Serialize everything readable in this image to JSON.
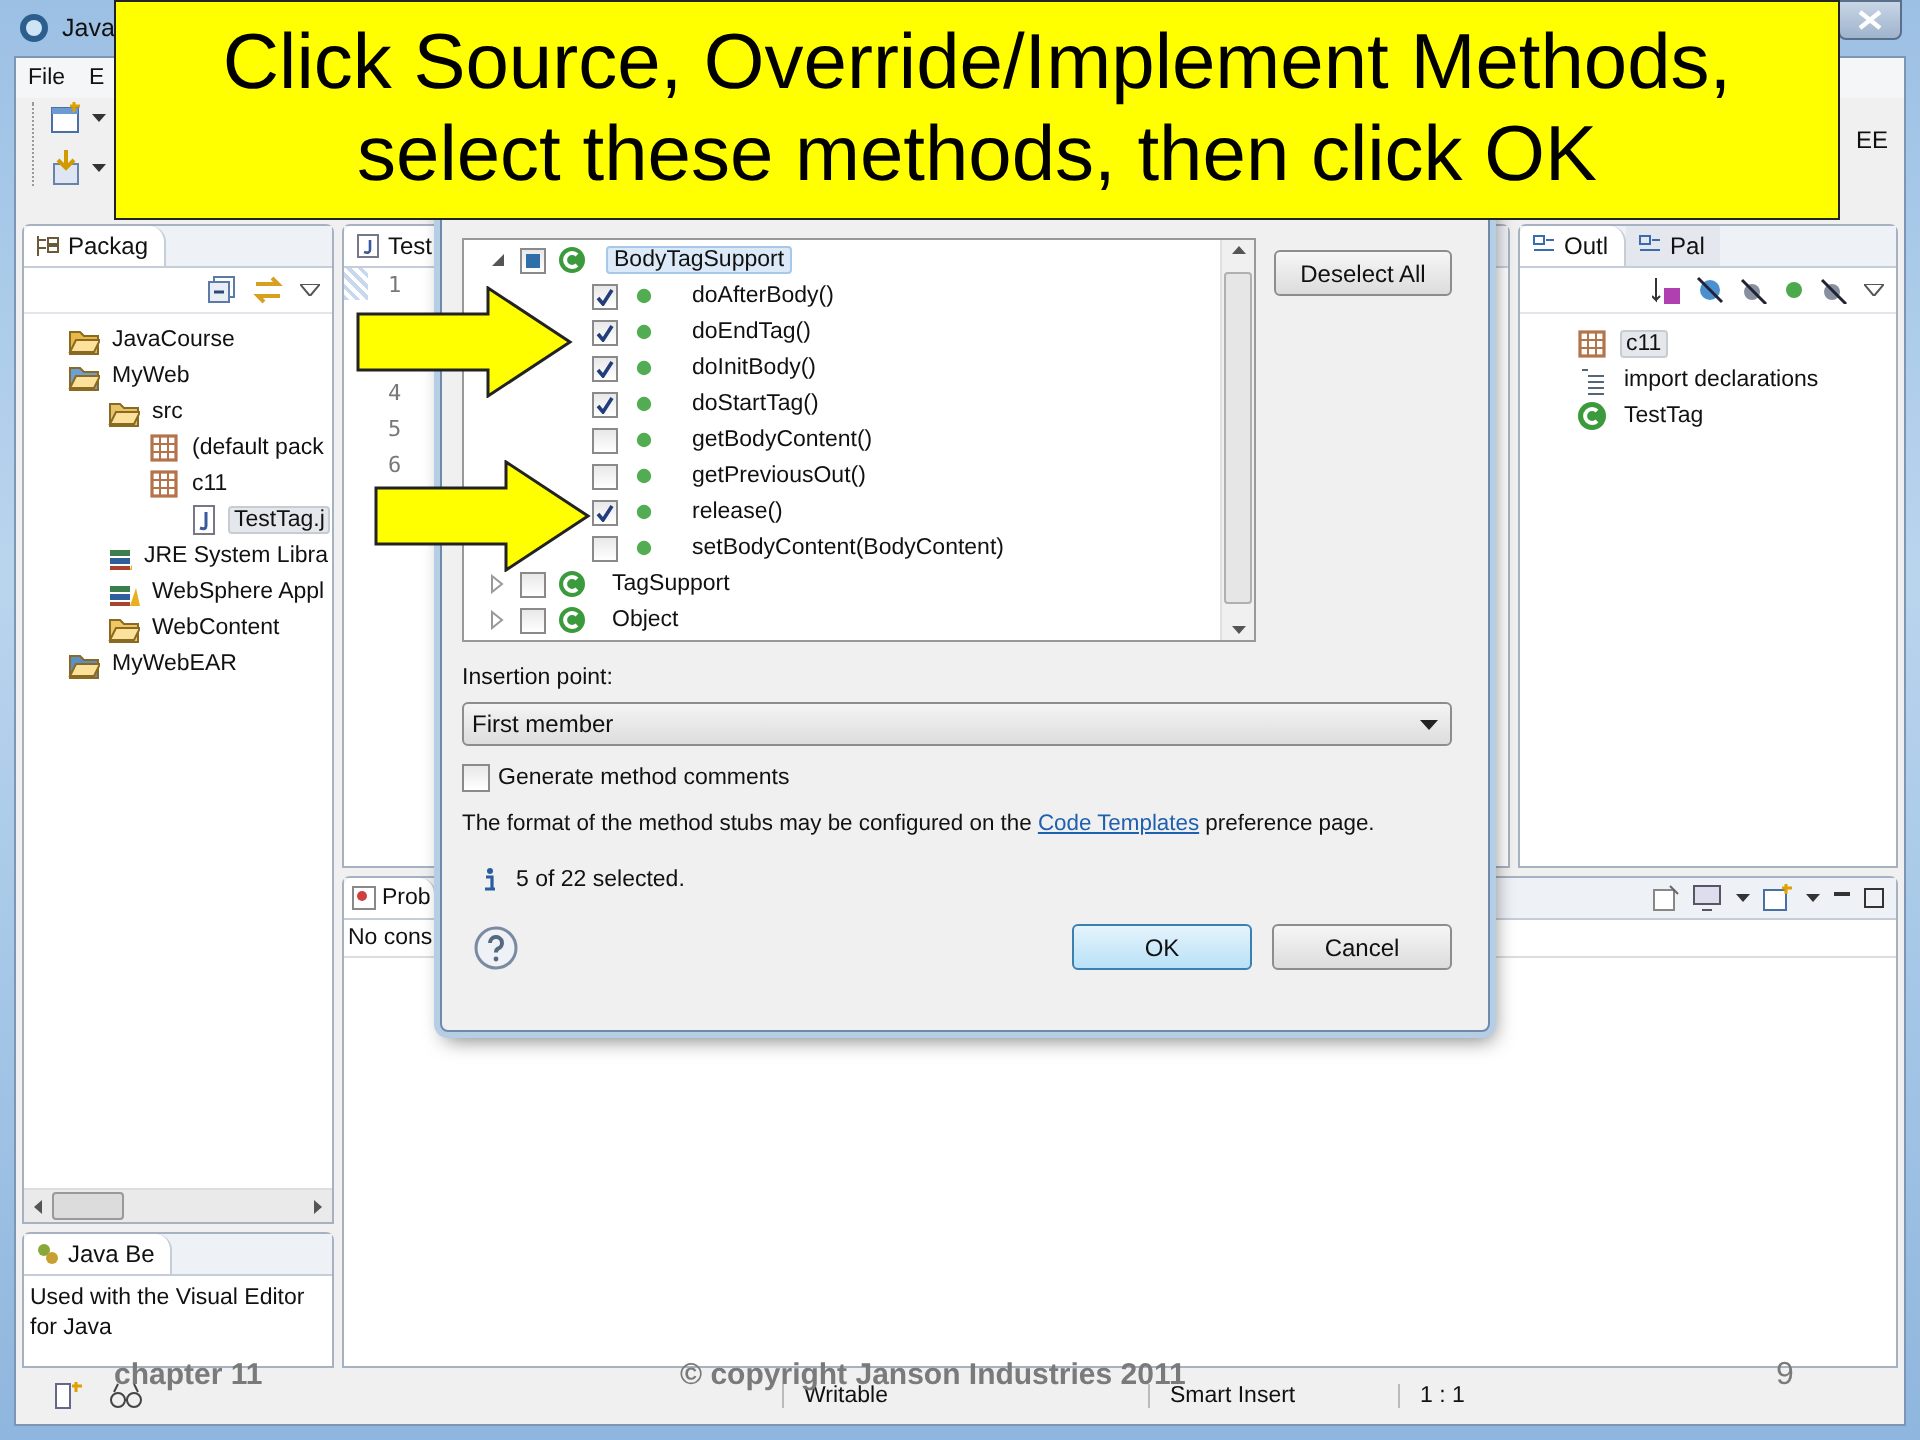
{
  "window": {
    "title": "Java"
  },
  "menu": [
    "File",
    "E"
  ],
  "perspective": "EE",
  "package_explorer": {
    "tab": "Packag",
    "tree": [
      {
        "label": "JavaCourse",
        "kind": "project",
        "selected": false
      },
      {
        "label": "MyWeb",
        "kind": "web-project",
        "selected": false,
        "children": [
          {
            "label": "src",
            "kind": "source-folder",
            "selected": false,
            "children": [
              {
                "label": "(default pack",
                "kind": "package",
                "selected": false
              },
              {
                "label": "c11",
                "kind": "package",
                "selected": false,
                "children": [
                  {
                    "label": "TestTag.j",
                    "kind": "file",
                    "selected": true
                  }
                ]
              }
            ]
          },
          {
            "label": "JRE System Libra",
            "kind": "library",
            "selected": false
          },
          {
            "label": "WebSphere Appl",
            "kind": "library",
            "selected": false
          },
          {
            "label": "WebContent",
            "kind": "folder",
            "selected": false
          }
        ]
      },
      {
        "label": "MyWebEAR",
        "kind": "ear-project",
        "selected": false
      }
    ]
  },
  "editor": {
    "tab": "Test",
    "line_numbers": [
      "1",
      "4",
      "5",
      "6"
    ]
  },
  "outline": {
    "tabs": [
      {
        "label": "Outl",
        "selected": true
      },
      {
        "label": "Pal",
        "selected": false
      }
    ],
    "items": [
      {
        "label": "c11",
        "kind": "package",
        "selected": true
      },
      {
        "label": "import declarations",
        "kind": "imports",
        "selected": false
      },
      {
        "label": "TestTag",
        "kind": "class",
        "selected": false
      }
    ]
  },
  "problems": {
    "tab": "Prob",
    "text": "No cons"
  },
  "java_beans": {
    "tab": "Java Be",
    "text": "Used with the Visual Editor for Java"
  },
  "status_bar": [
    "Writable",
    "Smart Insert",
    "1 : 1"
  ],
  "dialog": {
    "tree": [
      {
        "label": "BodyTagSupport",
        "checked": false,
        "partial": true,
        "expanded": true,
        "selected": true,
        "children": [
          {
            "label": "doAfterBody()",
            "checked": true
          },
          {
            "label": "doEndTag()",
            "checked": true
          },
          {
            "label": "doInitBody()",
            "checked": true
          },
          {
            "label": "doStartTag()",
            "checked": true
          },
          {
            "label": "getBodyContent()",
            "checked": false
          },
          {
            "label": "getPreviousOut()",
            "checked": false
          },
          {
            "label": "release()",
            "checked": true
          },
          {
            "label": "setBodyContent(BodyContent)",
            "checked": false
          }
        ]
      },
      {
        "label": "TagSupport",
        "checked": false,
        "partial": false,
        "expanded": false,
        "selected": false
      },
      {
        "label": "Object",
        "checked": false,
        "partial": false,
        "expanded": false,
        "selected": false
      }
    ],
    "side_button": "Deselect All",
    "insertion_label": "Insertion point:",
    "insertion_value": "First member",
    "comments": {
      "label": "Generate method comments",
      "checked": false
    },
    "note_before": "The format of the method stubs may be configured on the",
    "note_link": "Code Templates",
    "note_after": "preference page.",
    "status": "5 of 22 selected.",
    "buttons": [
      {
        "label": "OK",
        "default": true
      },
      {
        "label": "Cancel",
        "default": false
      }
    ]
  },
  "callout": "Click Source, Override/Implement Methods,\nselect these methods, then click OK",
  "footer": {
    "left": "chapter 11",
    "center": "© copyright Janson Industries 2011",
    "page": "9"
  }
}
